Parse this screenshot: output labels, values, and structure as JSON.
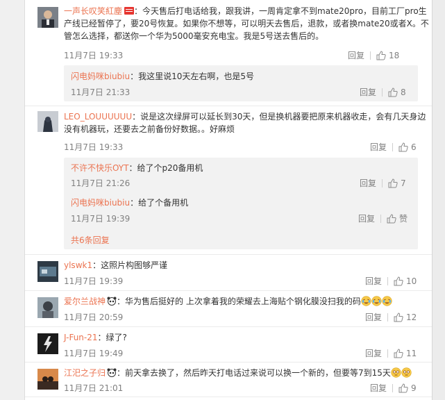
{
  "comments": [
    {
      "user": "一声长叹笑紅塵",
      "lines": [
        "：今天售后打电话给我，跟我讲，一周肯定拿不到mate20pro，目前工厂pro生",
        "产线已经暂停了，要20号恢复。如果你不想等，可以明天去售后，退款，或者换mate20或者X。不",
        "管怎么选择，都送你一个华为5000毫安充电宝。我是5号送去售后的。"
      ],
      "time": "11月7日 19:33",
      "reply_label": "回复",
      "likes": "18"
    },
    {
      "user": "LEO_LOUUUUUU",
      "lines": [
        "：说是这次绿屏可以延长到30天，但是换机器要把原来机器收走，会有几天身边",
        "没有机器玩，还要去之前备份好数据。。好麻烦"
      ],
      "time": "11月7日 19:33",
      "reply_label": "回复",
      "likes": "6"
    },
    {
      "user": "ylswk1",
      "text": "：这照片构图够严谨",
      "time": "11月7日 19:39",
      "reply_label": "回复",
      "likes": "10"
    },
    {
      "user": "爱尔兰战神",
      "text": "：华为售后挺好的  上次拿着我的荣耀去上海贴个钢化膜没扫我的码",
      "time": "11月7日 20:59",
      "reply_label": "回复",
      "likes": "12"
    },
    {
      "user": "J-Fun-21",
      "text": "：绿了?",
      "time": "11月7日 19:49",
      "reply_label": "回复",
      "likes": "11"
    },
    {
      "user": "江汜之子归",
      "text": "：前天拿去换了，然后昨天打电话过来说可以换一个新的，但要等7到15天",
      "time": "11月7日 21:01",
      "reply_label": "回复",
      "likes": "9"
    }
  ],
  "subreplies_1": [
    {
      "user": "闪电妈咪biubiu",
      "text": "：我这里说10天左右啊，也是5号",
      "time": "11月7日 21:33",
      "reply_label": "回复",
      "likes": "8"
    }
  ],
  "subreplies_2": [
    {
      "user": "不许不快乐OYT",
      "text": "：给了个p20备用机",
      "time": "11月7日 21:26",
      "reply_label": "回复",
      "likes": "7"
    },
    {
      "user": "闪电妈咪biubiu",
      "text": "：给了个备用机",
      "time": "11月7日 19:39",
      "reply_label": "回复",
      "likes": "赞"
    }
  ],
  "more_replies": "共6条回复",
  "colors": {
    "username": "#eb7350",
    "meta": "#808080",
    "subbox": "#f2f2f2",
    "background": "#ffffff"
  }
}
